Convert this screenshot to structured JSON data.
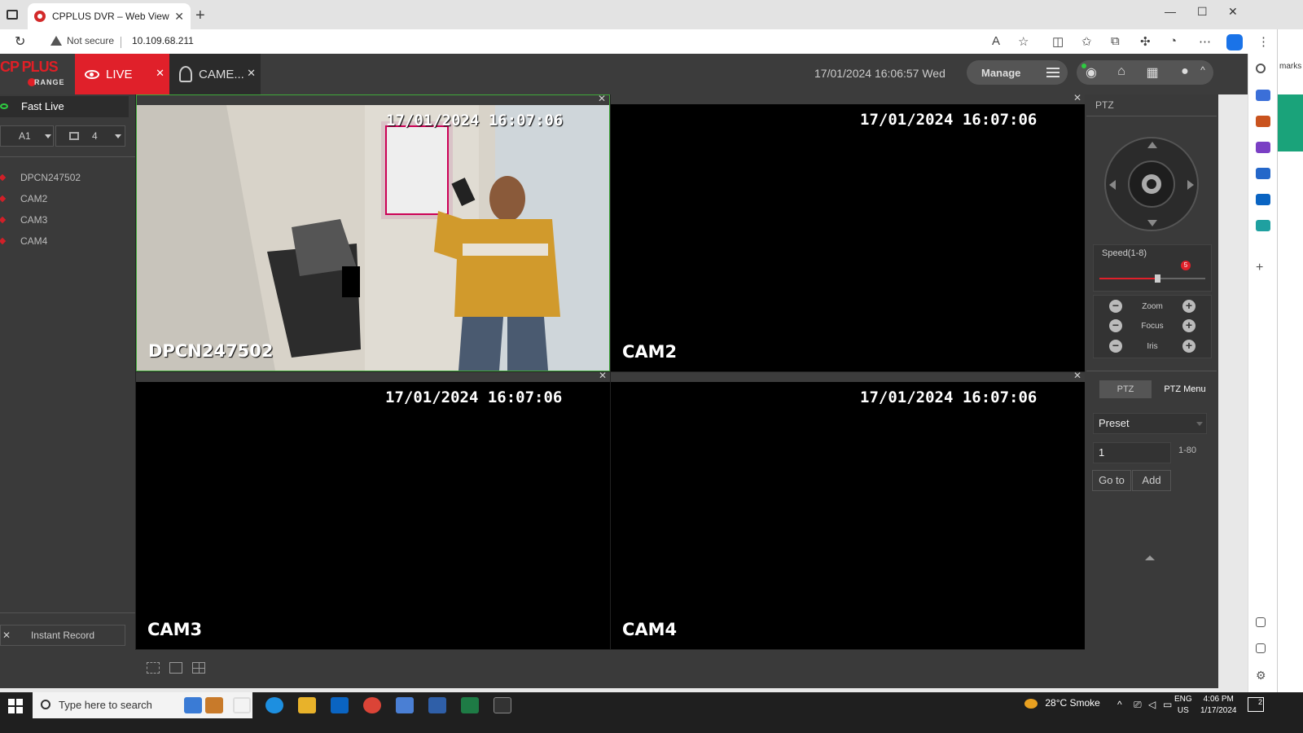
{
  "browser": {
    "tab_title": "CPPLUS DVR – Web View",
    "security_label": "Not secure",
    "url": "10.109.68.211",
    "side_text": "marks"
  },
  "app": {
    "logo_top": "CP PLUS",
    "logo_bottom": "RANGE",
    "tabs": [
      {
        "label": "LIVE"
      },
      {
        "label": "CAME..."
      }
    ],
    "datetime": "17/01/2024 16:06:57 Wed",
    "manage_label": "Manage"
  },
  "sidebar": {
    "fast_live": "Fast Live",
    "device_select": "A1",
    "grid_select": "4",
    "cameras": [
      "DPCN247502",
      "CAM2",
      "CAM3",
      "CAM4"
    ],
    "instant_record": "Instant Record"
  },
  "video": {
    "cells": [
      {
        "timestamp": "17/01/2024 16:07:06",
        "name": "DPCN247502",
        "active": true
      },
      {
        "timestamp": "17/01/2024 16:07:06",
        "name": "CAM2",
        "active": false
      },
      {
        "timestamp": "17/01/2024 16:07:06",
        "name": "CAM3",
        "active": false
      },
      {
        "timestamp": "17/01/2024 16:07:06",
        "name": "CAM4",
        "active": false
      }
    ]
  },
  "ptz": {
    "title": "PTZ",
    "speed_label": "Speed(1-8)",
    "speed_value": "5",
    "zoom_label": "Zoom",
    "focus_label": "Focus",
    "iris_label": "Iris",
    "tab_ptz": "PTZ",
    "tab_menu": "PTZ Menu",
    "preset_select": "Preset",
    "preset_value": "1",
    "preset_range": "1-80",
    "goto_label": "Go to",
    "add_label": "Add"
  },
  "taskbar": {
    "search_placeholder": "Type here to search",
    "weather": "28°C  Smoke",
    "lang_top": "ENG",
    "lang_bottom": "US",
    "time": "4:06 PM",
    "date": "1/17/2024",
    "notif_count": "2"
  },
  "colors": {
    "accent": "#e0202a",
    "active_border": "#3fa83a",
    "header_bg": "#3c3c3c"
  }
}
